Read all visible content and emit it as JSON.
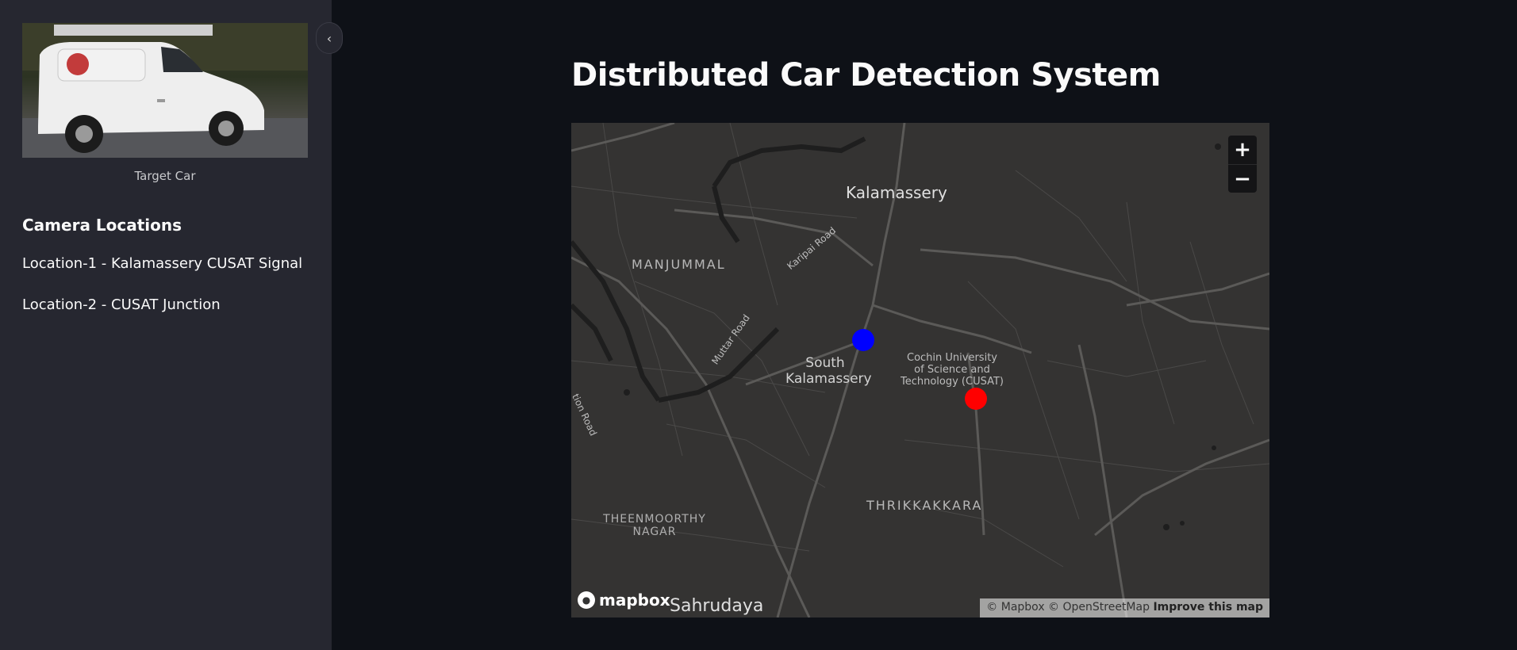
{
  "sidebar": {
    "image_caption": "Target Car",
    "camera_heading": "Camera Locations",
    "locations": [
      "Location-1 - Kalamassery CUSAT Signal",
      "Location-2 - CUSAT Junction"
    ]
  },
  "main": {
    "title": "Distributed Car Detection System"
  },
  "map": {
    "labels": {
      "kalamassery": "Kalamassery",
      "manjummal": "MANJUMMAL",
      "karipai_road": "Karipai Road",
      "muttar_road": "Muttar Road",
      "tion_road": "tion Road",
      "south_kalamassery_1": "South",
      "south_kalamassery_2": "Kalamassery",
      "cusat_1": "Cochin University",
      "cusat_2": "of Science and",
      "cusat_3": "Technology (CUSAT)",
      "thrikkakkara": "THRIKKAKKARA",
      "theenmoorthy_1": "THEENMOORTHY",
      "theenmoorthy_2": "NAGAR",
      "sahrudaya": "Sahrudaya"
    },
    "zoom_in": "+",
    "zoom_out": "−",
    "logo_text": "mapbox",
    "attribution": "© Mapbox © OpenStreetMap",
    "improve": "Improve this map",
    "markers": [
      {
        "name": "Location-1",
        "color": "#0000ff"
      },
      {
        "name": "Location-2",
        "color": "#ff0000"
      }
    ]
  },
  "colors": {
    "sidebar_bg": "#262730",
    "main_bg": "#0e1117",
    "map_bg": "#343332"
  }
}
